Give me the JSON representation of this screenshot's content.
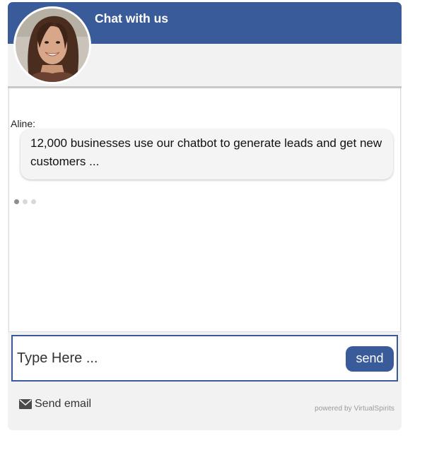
{
  "header": {
    "title": "Chat with us",
    "avatar_icon": "agent-avatar-photo"
  },
  "conversation": {
    "sender": "Aline:",
    "message": "12,000 businesses use our chatbot to generate leads and get new customers ...",
    "pagination": {
      "total": 3,
      "active": 1
    }
  },
  "composer": {
    "placeholder": "Type Here ...",
    "value": "",
    "send_label": "send"
  },
  "footer": {
    "email_icon": "envelope-icon",
    "email_label": "Send email",
    "powered_by": "powered by VirtualSpirits"
  },
  "colors": {
    "brand": "#3a5b9a",
    "panel": "#f2f2f2",
    "bubble": "#f4f4f4"
  }
}
